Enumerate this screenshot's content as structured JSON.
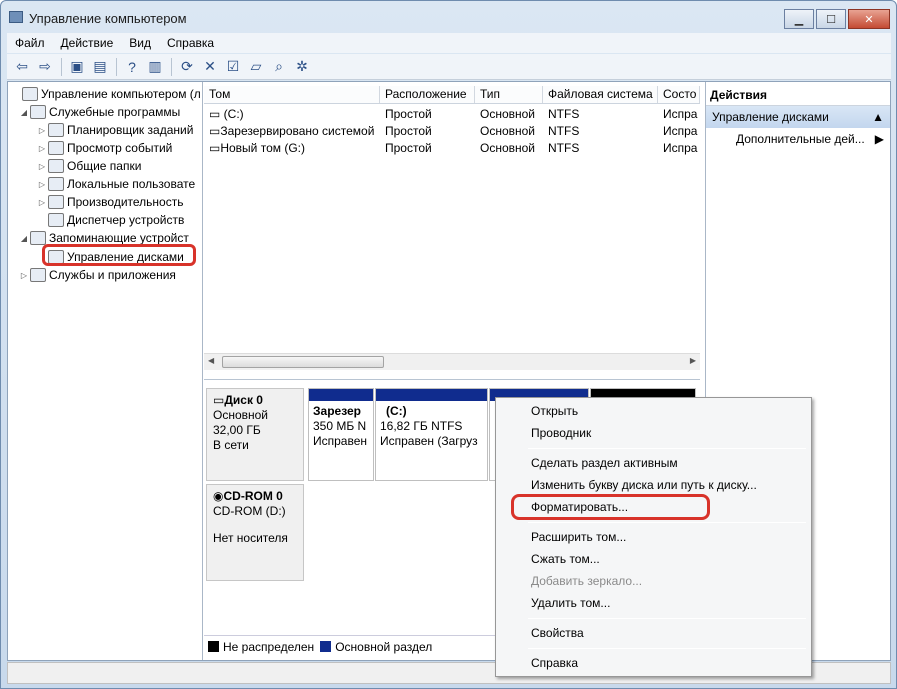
{
  "window": {
    "title": "Управление компьютером"
  },
  "menu": [
    "Файл",
    "Действие",
    "Вид",
    "Справка"
  ],
  "tree": {
    "root": "Управление компьютером (л",
    "items": [
      {
        "label": "Служебные программы",
        "level": 1
      },
      {
        "label": "Планировщик заданий",
        "level": 2
      },
      {
        "label": "Просмотр событий",
        "level": 2
      },
      {
        "label": "Общие папки",
        "level": 2
      },
      {
        "label": "Локальные пользовате",
        "level": 2
      },
      {
        "label": "Производительность",
        "level": 2
      },
      {
        "label": "Диспетчер устройств",
        "level": 2
      },
      {
        "label": "Запоминающие устройст",
        "level": 1
      },
      {
        "label": "Управление дисками",
        "level": 2
      },
      {
        "label": "Службы и приложения",
        "level": 1
      }
    ]
  },
  "volumes": {
    "columns": [
      "Том",
      "Расположение",
      "Тип",
      "Файловая система",
      "Состо"
    ],
    "rows": [
      [
        "(C:)",
        "Простой",
        "Основной",
        "NTFS",
        "Испра"
      ],
      [
        "Зарезервировано системой",
        "Простой",
        "Основной",
        "NTFS",
        "Испра"
      ],
      [
        "Новый том (G:)",
        "Простой",
        "Основной",
        "NTFS",
        "Испра"
      ]
    ]
  },
  "disks": {
    "disk0": {
      "name": "Диск 0",
      "type": "Основной",
      "size": "32,00 ГБ",
      "status": "В сети"
    },
    "p1": {
      "name": "Зарезер",
      "info": "350 МБ N",
      "status": "Исправен"
    },
    "p2": {
      "name": "(C:)",
      "info": "16,82 ГБ NTFS",
      "status": "Исправен (Загруз"
    },
    "cdrom": {
      "name": "CD-ROM 0",
      "drive": "CD-ROM (D:)",
      "status": "Нет носителя"
    }
  },
  "legend": {
    "unallocated": "Не распределен",
    "primary": "Основной раздел"
  },
  "actions": {
    "header": "Действия",
    "section": "Управление дисками",
    "more": "Дополнительные дей..."
  },
  "context_menu": {
    "open": "Открыть",
    "explorer": "Проводник",
    "mark_active": "Сделать раздел активным",
    "change_letter": "Изменить букву диска или путь к диску...",
    "format": "Форматировать...",
    "extend": "Расширить том...",
    "shrink": "Сжать том...",
    "add_mirror": "Добавить зеркало...",
    "delete": "Удалить том...",
    "properties": "Свойства",
    "help": "Справка"
  },
  "colors": {
    "primary_partition": "#102c8e",
    "unallocated": "#000000",
    "highlight": "#d8332a"
  }
}
